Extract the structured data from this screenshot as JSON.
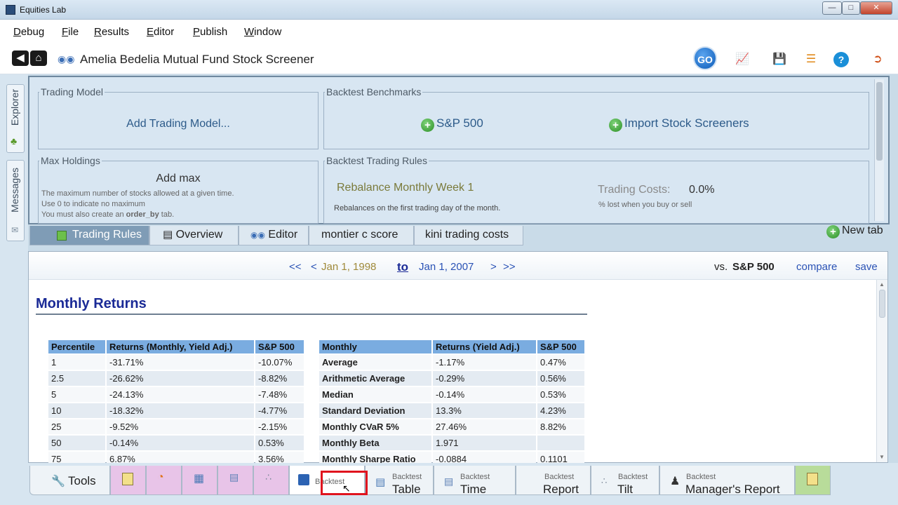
{
  "window": {
    "title": "Equities Lab",
    "controls": [
      "—",
      "□",
      "✕"
    ]
  },
  "menu": [
    "Debug",
    "File",
    "Results",
    "Editor",
    "Publish",
    "Window"
  ],
  "toolbar": {
    "document_title": "Amelia Bedelia Mutual Fund Stock Screener",
    "go_label": "GO"
  },
  "sidebar": {
    "explorer_label": "Explorer",
    "messages_label": "Messages"
  },
  "rules": {
    "trading_model": {
      "legend": "Trading Model",
      "action": "Add Trading Model..."
    },
    "benchmarks": {
      "legend": "Backtest Benchmarks",
      "sp500": "S&P 500",
      "import": "Import Stock Screeners"
    },
    "max_holdings": {
      "legend": "Max Holdings",
      "action": "Add max",
      "help1": "The maximum number of stocks allowed at a given time.",
      "help2": "Use 0 to indicate no maximum",
      "help3_pre": "You must also create an ",
      "help3_code": "order_by",
      "help3_post": " tab."
    },
    "trading_rules": {
      "legend": "Backtest Trading Rules",
      "rebalance": "Rebalance Monthly Week 1",
      "rebalance_note": "Rebalances on the first trading day of the month.",
      "costs_label": "Trading Costs:",
      "costs_value": "0.0%",
      "costs_note": "% lost when you buy or sell"
    }
  },
  "tabs": [
    "Trading Rules",
    "Overview",
    "Editor",
    "montier c score",
    "kini trading costs"
  ],
  "new_tab_label": "New tab",
  "datebar": {
    "prev_prev": "<<",
    "prev": "<",
    "start": "Jan 1, 1998",
    "to": "to",
    "end": "Jan 1, 2007",
    "next": ">",
    "next_next": ">>",
    "vs": "vs.",
    "benchmark": "S&P 500",
    "compare": "compare",
    "save": "save"
  },
  "section_title": "Monthly Returns",
  "percentile_table": {
    "headers": [
      "Percentile",
      "Returns (Monthly, Yield Adj.)",
      "S&P 500"
    ],
    "rows": [
      [
        "1",
        "-31.71%",
        "-10.07%"
      ],
      [
        "2.5",
        "-26.62%",
        "-8.82%"
      ],
      [
        "5",
        "-24.13%",
        "-7.48%"
      ],
      [
        "10",
        "-18.32%",
        "-4.77%"
      ],
      [
        "25",
        "-9.52%",
        "-2.15%"
      ],
      [
        "50",
        "-0.14%",
        "0.53%"
      ],
      [
        "75",
        "6.87%",
        "3.56%"
      ]
    ]
  },
  "monthly_table": {
    "headers": [
      "Monthly",
      "Returns (Yield Adj.)",
      "S&P 500"
    ],
    "rows": [
      [
        "Average",
        "-1.17%",
        "0.47%"
      ],
      [
        "Arithmetic Average",
        "-0.29%",
        "0.56%"
      ],
      [
        "Median",
        "-0.14%",
        "0.53%"
      ],
      [
        "Standard Deviation",
        "13.3%",
        "4.23%"
      ],
      [
        "Monthly CVaR 5%",
        "27.46%",
        "8.82%"
      ],
      [
        "Monthly Beta",
        "1.971",
        ""
      ],
      [
        "Monthly Sharpe Ratio",
        "-0.0884",
        "0.1101"
      ]
    ]
  },
  "bottom": {
    "tools": "Tools",
    "backtest_chart_small": "Backtest",
    "backtest_table_small": "Backtest",
    "backtest_table": "Table",
    "backtest_time_small": "Backtest",
    "backtest_time": "Time",
    "backtest_report_small": "Backtest",
    "backtest_report": "Report",
    "backtest_tilt_small": "Backtest",
    "backtest_tilt": "Tilt",
    "backtest_manager_small": "Backtest",
    "backtest_manager": "Manager's Report"
  }
}
